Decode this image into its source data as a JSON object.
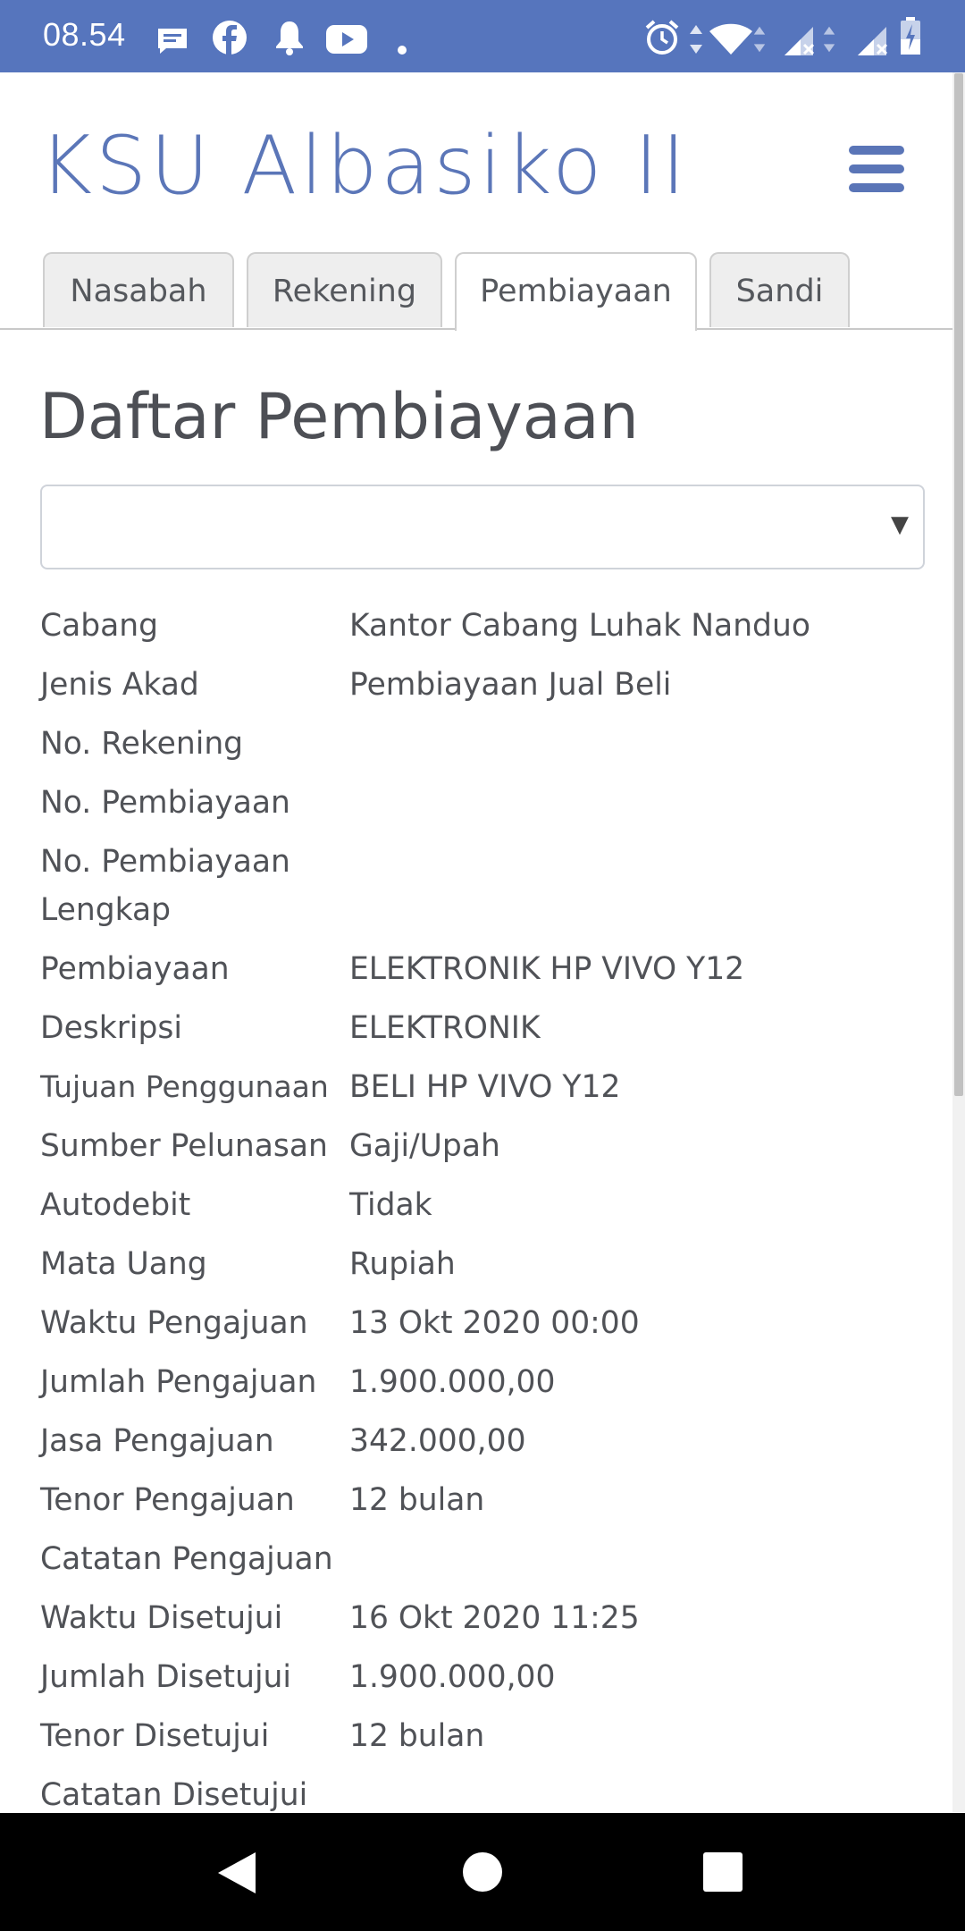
{
  "status_bar": {
    "time": "08.54",
    "left_icons": [
      "message-icon",
      "facebook-icon",
      "bell-icon",
      "youtube-icon",
      "dot-icon"
    ],
    "right_icons": [
      "alarm-icon",
      "data-arrows-icon",
      "wifi-icon",
      "signal-icon",
      "signal-icon",
      "battery-charging-icon"
    ]
  },
  "header": {
    "title": "KSU Albasiko II",
    "menu_icon": "hamburger-menu-icon"
  },
  "tabs": [
    {
      "label": "Nasabah",
      "active": false
    },
    {
      "label": "Rekening",
      "active": false
    },
    {
      "label": "Pembiayaan",
      "active": true
    },
    {
      "label": "Sandi",
      "active": false
    }
  ],
  "main": {
    "title": "Daftar Pembiayaan",
    "select": {
      "value": ""
    },
    "details": [
      {
        "label": "Cabang",
        "value": "Kantor Cabang Luhak Nanduo"
      },
      {
        "label": "Jenis Akad",
        "value": "Pembiayaan Jual Beli"
      },
      {
        "label": "No. Rekening",
        "value": ""
      },
      {
        "label": "No. Pembiayaan",
        "value": ""
      },
      {
        "label": "No. Pembiayaan Lengkap",
        "value": ""
      },
      {
        "label": "Pembiayaan",
        "value": "ELEKTRONIK HP VIVO Y12"
      },
      {
        "label": "Deskripsi",
        "value": "ELEKTRONIK"
      },
      {
        "label": "Tujuan Penggunaan",
        "value": "BELI HP VIVO Y12"
      },
      {
        "label": "Sumber Pelunasan",
        "value": "Gaji/Upah"
      },
      {
        "label": "Autodebit",
        "value": "Tidak"
      },
      {
        "label": "Mata Uang",
        "value": "Rupiah"
      },
      {
        "label": "Waktu Pengajuan",
        "value": "13 Okt 2020 00:00"
      },
      {
        "label": "Jumlah Pengajuan",
        "value": "1.900.000,00"
      },
      {
        "label": "Jasa Pengajuan",
        "value": "342.000,00"
      },
      {
        "label": "Tenor Pengajuan",
        "value": "12 bulan"
      },
      {
        "label": "Catatan Pengajuan",
        "value": ""
      },
      {
        "label": "Waktu Disetujui",
        "value": "16 Okt 2020 11:25"
      },
      {
        "label": "Jumlah Disetujui",
        "value": "1.900.000,00"
      },
      {
        "label": "Tenor Disetujui",
        "value": "12 bulan"
      },
      {
        "label": "Catatan Disetujui",
        "value": ""
      }
    ]
  },
  "nav_bar": {
    "buttons": [
      "back-icon",
      "home-icon",
      "recents-icon"
    ]
  },
  "colors": {
    "status_bar": "#5675bd",
    "brand": "#5b76b8",
    "text": "#505257",
    "nav_bar": "#000000"
  }
}
